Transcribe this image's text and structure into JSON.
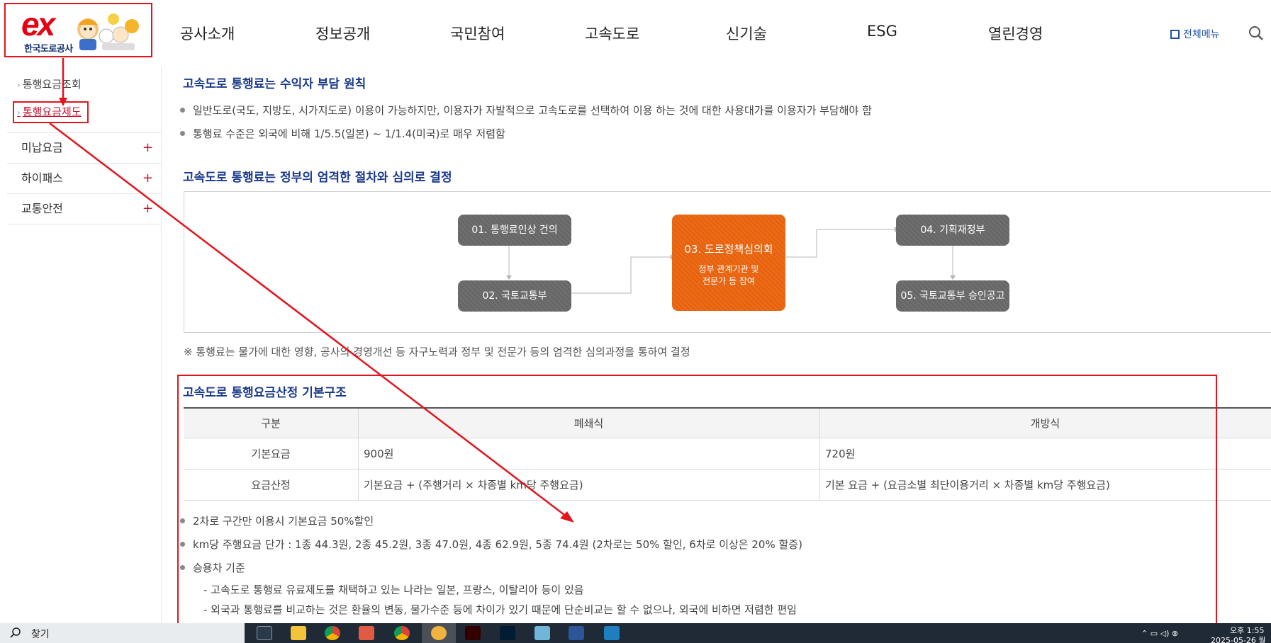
{
  "header": {
    "logo_mark": "ex",
    "logo_text": "한국도로공사",
    "nav": [
      "공사소개",
      "정보공개",
      "국민참여",
      "고속도로",
      "신기술",
      "ESG",
      "열린경영"
    ],
    "all_menu": "전체메뉴",
    "search_icon": "search-icon"
  },
  "sidebar": {
    "sub_items": [
      "통행요금조회",
      "통행요금제도"
    ],
    "active_sub": "통행요금제도",
    "main_items": [
      "미납요금",
      "하이패스",
      "교통안전"
    ],
    "expand_symbol": "+"
  },
  "content": {
    "section1": {
      "title": "고속도로 통행료는 수익자 부담 원칙",
      "bullets": [
        "일반도로(국도, 지방도, 시가지도로) 이용이 가능하지만, 이용자가 자발적으로 고속도로를 선택하여 이용 하는 것에 대한 사용대가를 이용자가 부담해야 함",
        "통행료 수준은 외국에 비해 1/5.5(일본) ~ 1/1.4(미국)로 매우 저렴함"
      ]
    },
    "section2": {
      "title": "고속도로 통행료는 정부의 엄격한 절차와 심의로 결정",
      "flow": {
        "n1": "01.  통행료인상 건의",
        "n2": "02. 국토교통부",
        "n3_title": "03.  도로정책심의회",
        "n3_sub1": "정부 관계기관 및",
        "n3_sub2": "전문가 등 참여",
        "n4": "04. 기획재정부",
        "n5": "05. 국토교통부 승인공고"
      },
      "note": "※ 통행료는 물가에 대한 영향, 공사의 경영개선 등 자구노력과 정부 및 전문가 등의 엄격한 심의과정을 통하여 결정"
    },
    "section3": {
      "title": "고속도로 통행요금산정 기본구조",
      "table": {
        "headers": [
          "구분",
          "폐쇄식",
          "개방식"
        ],
        "rows": [
          [
            "기본요금",
            "900원",
            "720원"
          ],
          [
            "요금산정",
            "기본요금 + (주행거리 × 차종별 km당 주행요금)",
            "기본 요금 + (요금소별 최단이용거리 × 차종별 km당 주행요금)"
          ]
        ]
      },
      "bullets": [
        "2차로 구간만 이용시 기본요금 50%할인",
        "km당 주행요금 단가 : 1종 44.3원, 2종 45.2원, 3종 47.0원, 4종 62.9원, 5종 74.4원 (2차로는 50% 할인, 6차로 이상은 20% 할증)",
        "승용차 기준"
      ],
      "sub_notes": [
        "- 고속도로 통행료 유료제도를 채택하고 있는 나라는 일본, 프랑스, 이탈리아 등이 있음",
        "- 외국과 통행료를 비교하는 것은 환율의 변동, 물가수준 등에 차이가 있기 때문에 단순비교는 할 수 없으나, 외국에 비하면 저렴한 편임"
      ]
    }
  },
  "taskbar": {
    "search_label": "찾기",
    "clock_time": "오후 1:55",
    "clock_date": "2025-05-26 월"
  },
  "colors": {
    "brand_red": "#e60012",
    "title_blue": "#1a3a8a",
    "orange_node": "#e8620c",
    "gray_node": "#676767",
    "annotation_red": "#e3141e"
  }
}
